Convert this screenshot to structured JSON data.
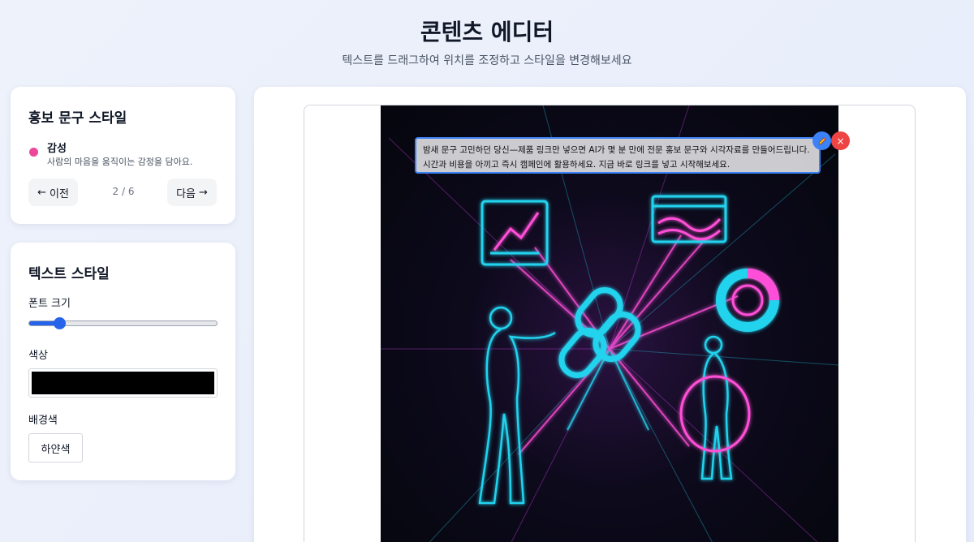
{
  "header": {
    "title": "콘텐츠 에디터",
    "subtitle": "텍스트를 드래그하여 위치를 조정하고 스타일을 변경해보세요"
  },
  "promo_style": {
    "heading": "홍보 문구 스타일",
    "style_name": "감성",
    "style_desc": "사람의 마음을 움직이는 감정을 담아요.",
    "style_color": "#ec4899",
    "prev_label": "이전",
    "next_label": "다음",
    "page_indicator": "2 / 6"
  },
  "text_style": {
    "heading": "텍스트 스타일",
    "font_size_label": "폰트 크기",
    "font_size_level": 0.16,
    "color_label": "색상",
    "color_value": "#000000",
    "bg_label": "배경색",
    "bg_button": "하얀색"
  },
  "canvas": {
    "text_line_1": "밤새 문구 고민하던 당신—제품 링크만 넣으면 AI가 몇 분 만에 전문 홍보 문구와 시각자료를 만들어드립니다.",
    "text_line_2": "시간과 비용을 아끼고 즉시 캠페인에 활용하세요. 지금 바로 링크를 넣고 시작해보세요.",
    "delete_glyph": "×"
  },
  "colors": {
    "accent": "#3b82f6",
    "danger": "#ef4444",
    "neon_cyan": "#22d3ee",
    "neon_magenta": "#e040fb"
  }
}
